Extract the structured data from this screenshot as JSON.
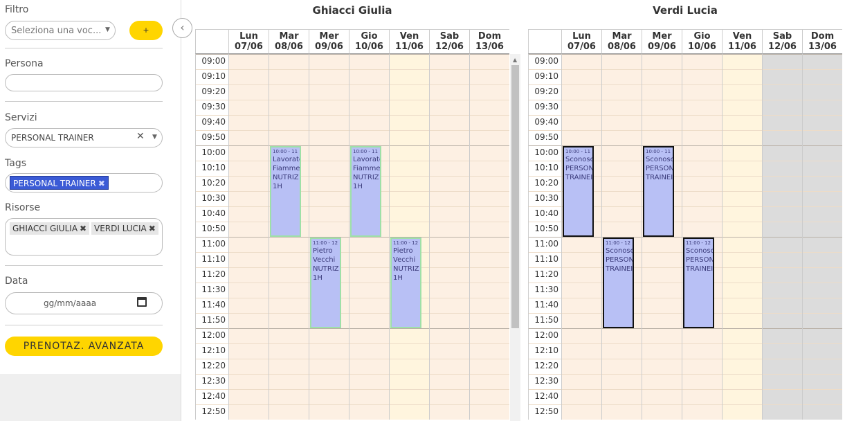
{
  "sidebar": {
    "filtro_label": "Filtro",
    "filtro_placeholder": "Seleziona una voc...",
    "add_label": "+",
    "persona_label": "Persona",
    "servizi_label": "Servizi",
    "servizi_value": "PERSONAL TRAINER",
    "tags_label": "Tags",
    "tag_value": "PERSONAL TRAINER",
    "risorse_label": "Risorse",
    "risorse": [
      "GHIACCI GIULIA",
      "VERDI LUCIA"
    ],
    "data_label": "Data",
    "date_placeholder": "gg/mm/aaaa",
    "advanced_button": "PRENOTAZ. AVANZATA"
  },
  "days": [
    {
      "name": "Lun",
      "date": "07/06"
    },
    {
      "name": "Mar",
      "date": "08/06"
    },
    {
      "name": "Mer",
      "date": "09/06"
    },
    {
      "name": "Gio",
      "date": "10/06"
    },
    {
      "name": "Ven",
      "date": "11/06"
    },
    {
      "name": "Sab",
      "date": "12/06"
    },
    {
      "name": "Dom",
      "date": "13/06"
    }
  ],
  "times": [
    "09:00",
    "09:10",
    "09:20",
    "09:30",
    "09:40",
    "09:50",
    "10:00",
    "10:10",
    "10:20",
    "10:30",
    "10:40",
    "10:50",
    "11:00",
    "11:10",
    "11:20",
    "11:30",
    "11:40",
    "11:50",
    "12:00",
    "12:10",
    "12:20",
    "12:30",
    "12:40",
    "12:50"
  ],
  "calendars": [
    {
      "title": "Ghiacci Giulia",
      "disabled_days": [],
      "events": [
        {
          "day": 1,
          "start": "10:00",
          "end": "11:00",
          "time": "10:00 - 11",
          "lines": [
            "Lavorato",
            "Fiamme",
            "NUTRIZ",
            "1H"
          ],
          "style": "g"
        },
        {
          "day": 3,
          "start": "10:00",
          "end": "11:00",
          "time": "10:00 - 11",
          "lines": [
            "Lavorato",
            "Fiamme",
            "NUTRIZ",
            "1H"
          ],
          "style": "g"
        },
        {
          "day": 2,
          "start": "11:00",
          "end": "12:00",
          "time": "11:00 - 12",
          "lines": [
            "Pietro",
            "Vecchi",
            "NUTRIZ",
            "1H"
          ],
          "style": "g"
        },
        {
          "day": 4,
          "start": "11:00",
          "end": "12:00",
          "time": "11:00 - 12",
          "lines": [
            "Pietro",
            "Vecchi",
            "NUTRIZ",
            "1H"
          ],
          "style": "g"
        }
      ]
    },
    {
      "title": "Verdi Lucia",
      "disabled_days": [
        5,
        6
      ],
      "events": [
        {
          "day": 0,
          "start": "10:00",
          "end": "11:00",
          "time": "10:00 - 11",
          "lines": [
            "Sconosc",
            "PERSON",
            "TRAINEI"
          ],
          "style": "k"
        },
        {
          "day": 2,
          "start": "10:00",
          "end": "11:00",
          "time": "10:00 - 11",
          "lines": [
            "Sconosc",
            "PERSON",
            "TRAINEI"
          ],
          "style": "k"
        },
        {
          "day": 1,
          "start": "11:00",
          "end": "12:00",
          "time": "11:00 - 12",
          "lines": [
            "Sconosc",
            "PERSON",
            "TRAINEI"
          ],
          "style": "k"
        },
        {
          "day": 3,
          "start": "11:00",
          "end": "12:00",
          "time": "11:00 - 12",
          "lines": [
            "Sconosc",
            "PERSON",
            "TRAINEI"
          ],
          "style": "k"
        }
      ]
    }
  ],
  "colors": {
    "accent": "#ffd500",
    "weekday_bg": "#fdf0e3",
    "today_bg": "#fff5de",
    "disabled_bg": "#dcdcdc",
    "event_bg": "#b8c0f5"
  }
}
